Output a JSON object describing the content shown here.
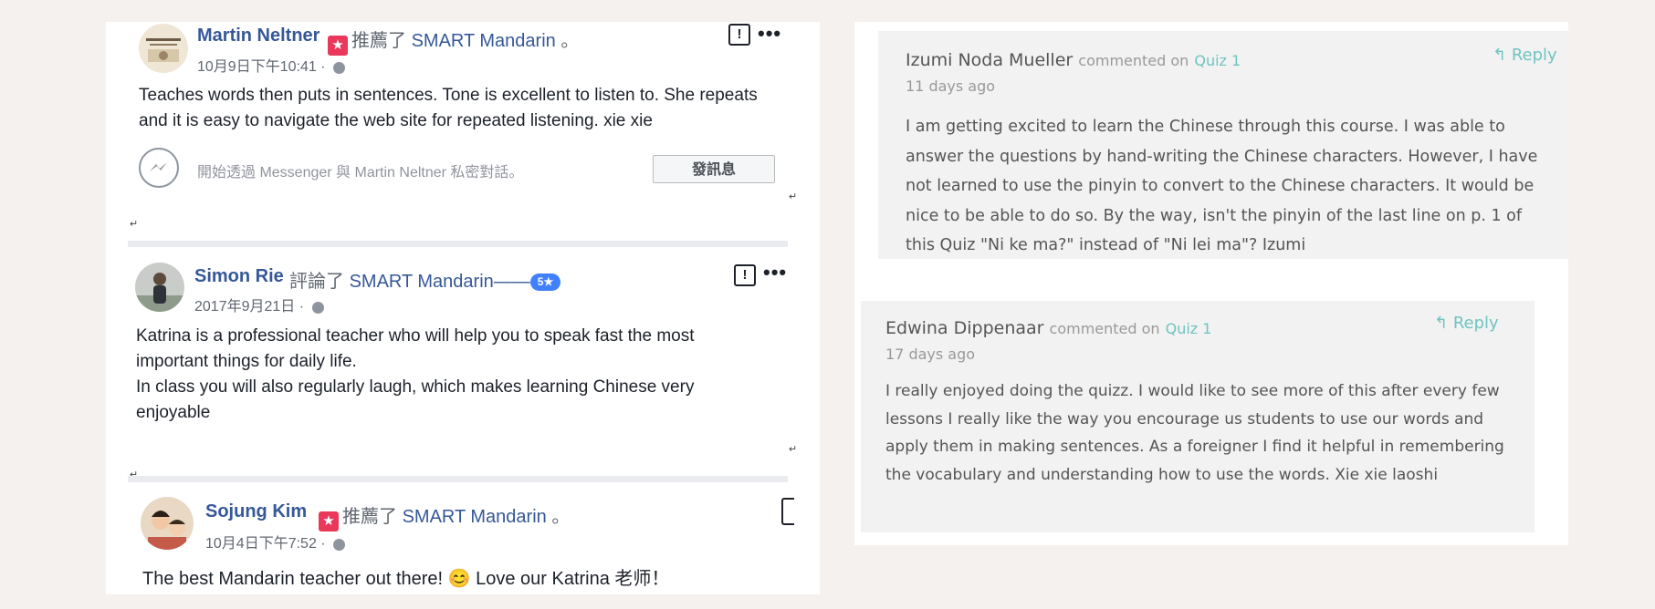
{
  "facebook": {
    "posts": [
      {
        "author": "Martin Neltner",
        "verb": "推薦了",
        "page": "SMART Mandarin",
        "suffix": "。",
        "time": "10月9日下午10:41 ·",
        "text": "Teaches words then puts in sentences. Tone is excellent to listen to. She repeats and it is easy to navigate the web site for repeated listening. xie xie",
        "messenger_prompt": "開始透過 Messenger 與 Martin Neltner 私密對話。",
        "send_label": "發訊息"
      },
      {
        "author": "Simon Rie",
        "verb": "評論了",
        "page": "SMART Mandarin",
        "separator": "——",
        "rating": "5★",
        "time": "2017年9月21日 ·",
        "text_line1": "Katrina is a professional teacher who will help you to speak fast the most important things for daily life.",
        "text_line2": "In class you will also regularly laugh, which makes learning Chinese very enjoyable"
      },
      {
        "author": "Sojung Kim",
        "verb": "推薦了",
        "page": "SMART Mandarin",
        "suffix": "。",
        "time": "10月4日下午7:52 ·",
        "text": "The best Mandarin teacher out there! 😊 Love our Katrina 老师！"
      }
    ],
    "paragraph_mark": "↵"
  },
  "comments": [
    {
      "author": "Izumi Noda Mueller",
      "commented_on": "commented on",
      "target": "Quiz 1",
      "time": "11 days ago",
      "reply": "Reply",
      "text": "I am getting excited to learn the Chinese through this course. I was able to answer the questions by hand-writing the Chinese characters. However, I have not learned to use the pinyin to convert to the Chinese characters. It would be nice to be able to do so. By the way, isn't the pinyin of the last line on p. 1 of this Quiz \"Ni ke ma?\" instead of \"Ni lei ma\"? Izumi"
    },
    {
      "author": "Edwina Dippenaar",
      "commented_on": "commented on",
      "target": "Quiz 1",
      "time": "17 days ago",
      "reply": "Reply",
      "text": "I really enjoyed doing the quizz. I would like to see more of this after every few lessons I really like the way you encourage us students to use our words and apply them in making sentences. As a foreigner I find it helpful in remembering the vocabulary and understanding how to use the words. Xie xie laoshi"
    }
  ],
  "colors": {
    "fb_link": "#365899",
    "recommend_badge": "#e9385a",
    "rating_badge": "#4080ff",
    "accent_teal": "#6fc4c0",
    "page_background": "#f4f1ef"
  },
  "icons": [
    "recommend-star-icon",
    "globe-icon",
    "report-icon",
    "more-options-icon",
    "messenger-icon",
    "reply-arrow-icon"
  ]
}
